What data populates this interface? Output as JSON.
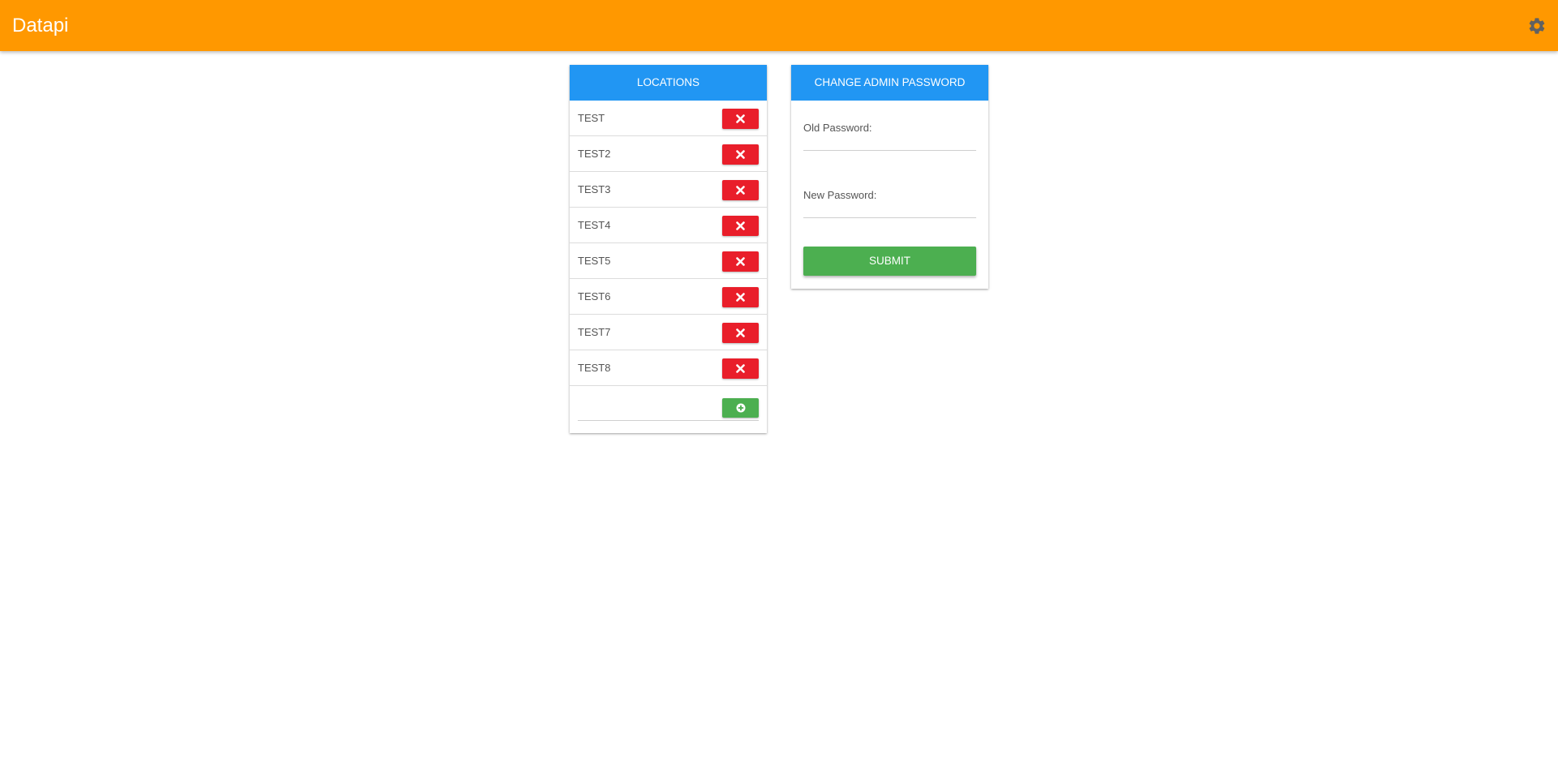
{
  "app": {
    "title": "Datapi"
  },
  "header": {
    "settings_icon": "gear-icon"
  },
  "locations": {
    "title": "LOCATIONS",
    "items": [
      {
        "name": "TEST"
      },
      {
        "name": "TEST2"
      },
      {
        "name": "TEST3"
      },
      {
        "name": "TEST4"
      },
      {
        "name": "TEST5"
      },
      {
        "name": "TEST6"
      },
      {
        "name": "TEST7"
      },
      {
        "name": "TEST8"
      }
    ],
    "delete_icon": "close-icon",
    "new_location_value": "",
    "add_icon": "plus-circle-icon"
  },
  "password": {
    "title": "CHANGE ADMIN PASSWORD",
    "old_label": "Old Password:",
    "old_value": "",
    "new_label": "New Password:",
    "new_value": "",
    "submit_label": "SUBMIT"
  },
  "colors": {
    "header_bar": "#ff9800",
    "card_header": "#2196f3",
    "delete": "#e91e2a",
    "success": "#4caf50",
    "gear": "#616161"
  }
}
